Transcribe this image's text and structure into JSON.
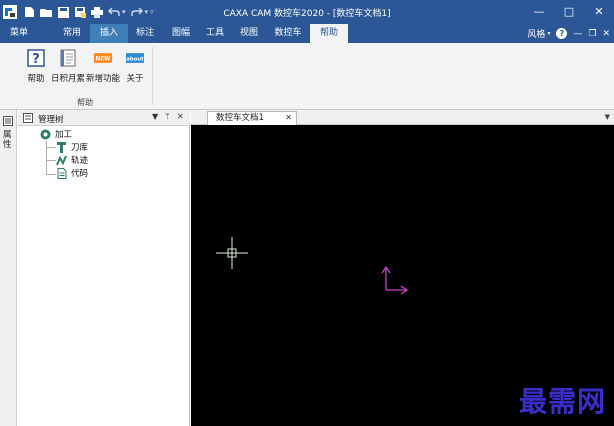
{
  "window": {
    "title": "CAXA CAM 数控车2020 - [数控车文档1]",
    "controls": [
      "—",
      "□",
      "✕"
    ]
  },
  "quick_access": {
    "icons": [
      "new-file-icon",
      "open-folder-icon",
      "save-icon",
      "save-as-icon",
      "print-icon",
      "undo-icon",
      "redo-icon",
      "customize-icon"
    ]
  },
  "ribbon_tabs": [
    {
      "label": "菜单"
    },
    {
      "label": "常用"
    },
    {
      "label": "插入"
    },
    {
      "label": "标注"
    },
    {
      "label": "图幅"
    },
    {
      "label": "工具"
    },
    {
      "label": "视图"
    },
    {
      "label": "数控车"
    },
    {
      "label": "帮助"
    }
  ],
  "active_tab": "帮助",
  "right_tools": {
    "style_label": "风格",
    "help": "?",
    "min": "—",
    "restore": "❐",
    "close": "✕"
  },
  "ribbon_panel": {
    "buttons": [
      {
        "label": "帮助",
        "icon": "help-book-icon"
      },
      {
        "label": "日积月累",
        "icon": "tips-calendar-icon"
      },
      {
        "label": "新增功能",
        "icon": "new-badge-icon",
        "badge": "NEW"
      },
      {
        "label": "关于",
        "icon": "about-badge-icon",
        "badge": "about"
      }
    ],
    "group_label": "帮助"
  },
  "side_strip": {
    "label": "属性"
  },
  "manager_panel": {
    "title": "管理树",
    "controls": [
      "▼",
      "ᛘ",
      "✕"
    ],
    "tree": {
      "root": "加工",
      "children": [
        "刀库",
        "轨迹",
        "代码"
      ]
    }
  },
  "document_tabs": {
    "active": "数控车文档1",
    "close": "✕",
    "menu": "▼"
  },
  "canvas": {
    "background": "#000000",
    "watermark": "最需网"
  },
  "colors": {
    "titlebar": "#2b5797",
    "ribbon_bg": "#f3f3f3",
    "accent": "#2b5797",
    "cursor": "#d8f0d8",
    "axis": "#c840c8"
  }
}
